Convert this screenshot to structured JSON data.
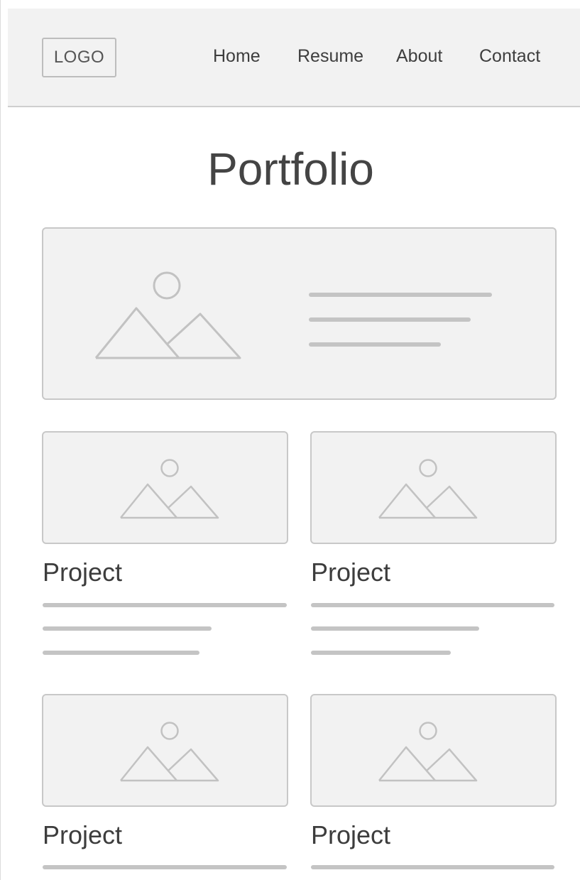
{
  "header": {
    "logo_text": "LOGO",
    "nav": [
      "Home",
      "Resume",
      "About",
      "Contact"
    ]
  },
  "main": {
    "title": "Portfolio",
    "featured": {
      "image_icon": "image-placeholder-icon"
    },
    "projects": [
      {
        "title": "Project"
      },
      {
        "title": "Project"
      },
      {
        "title": "Project"
      },
      {
        "title": "Project"
      }
    ]
  },
  "colors": {
    "header_bg": "#f2f2f2",
    "placeholder_bg": "#f2f2f2",
    "placeholder_border": "#c8c8c8",
    "line": "#c4c4c4",
    "text": "#444444"
  }
}
